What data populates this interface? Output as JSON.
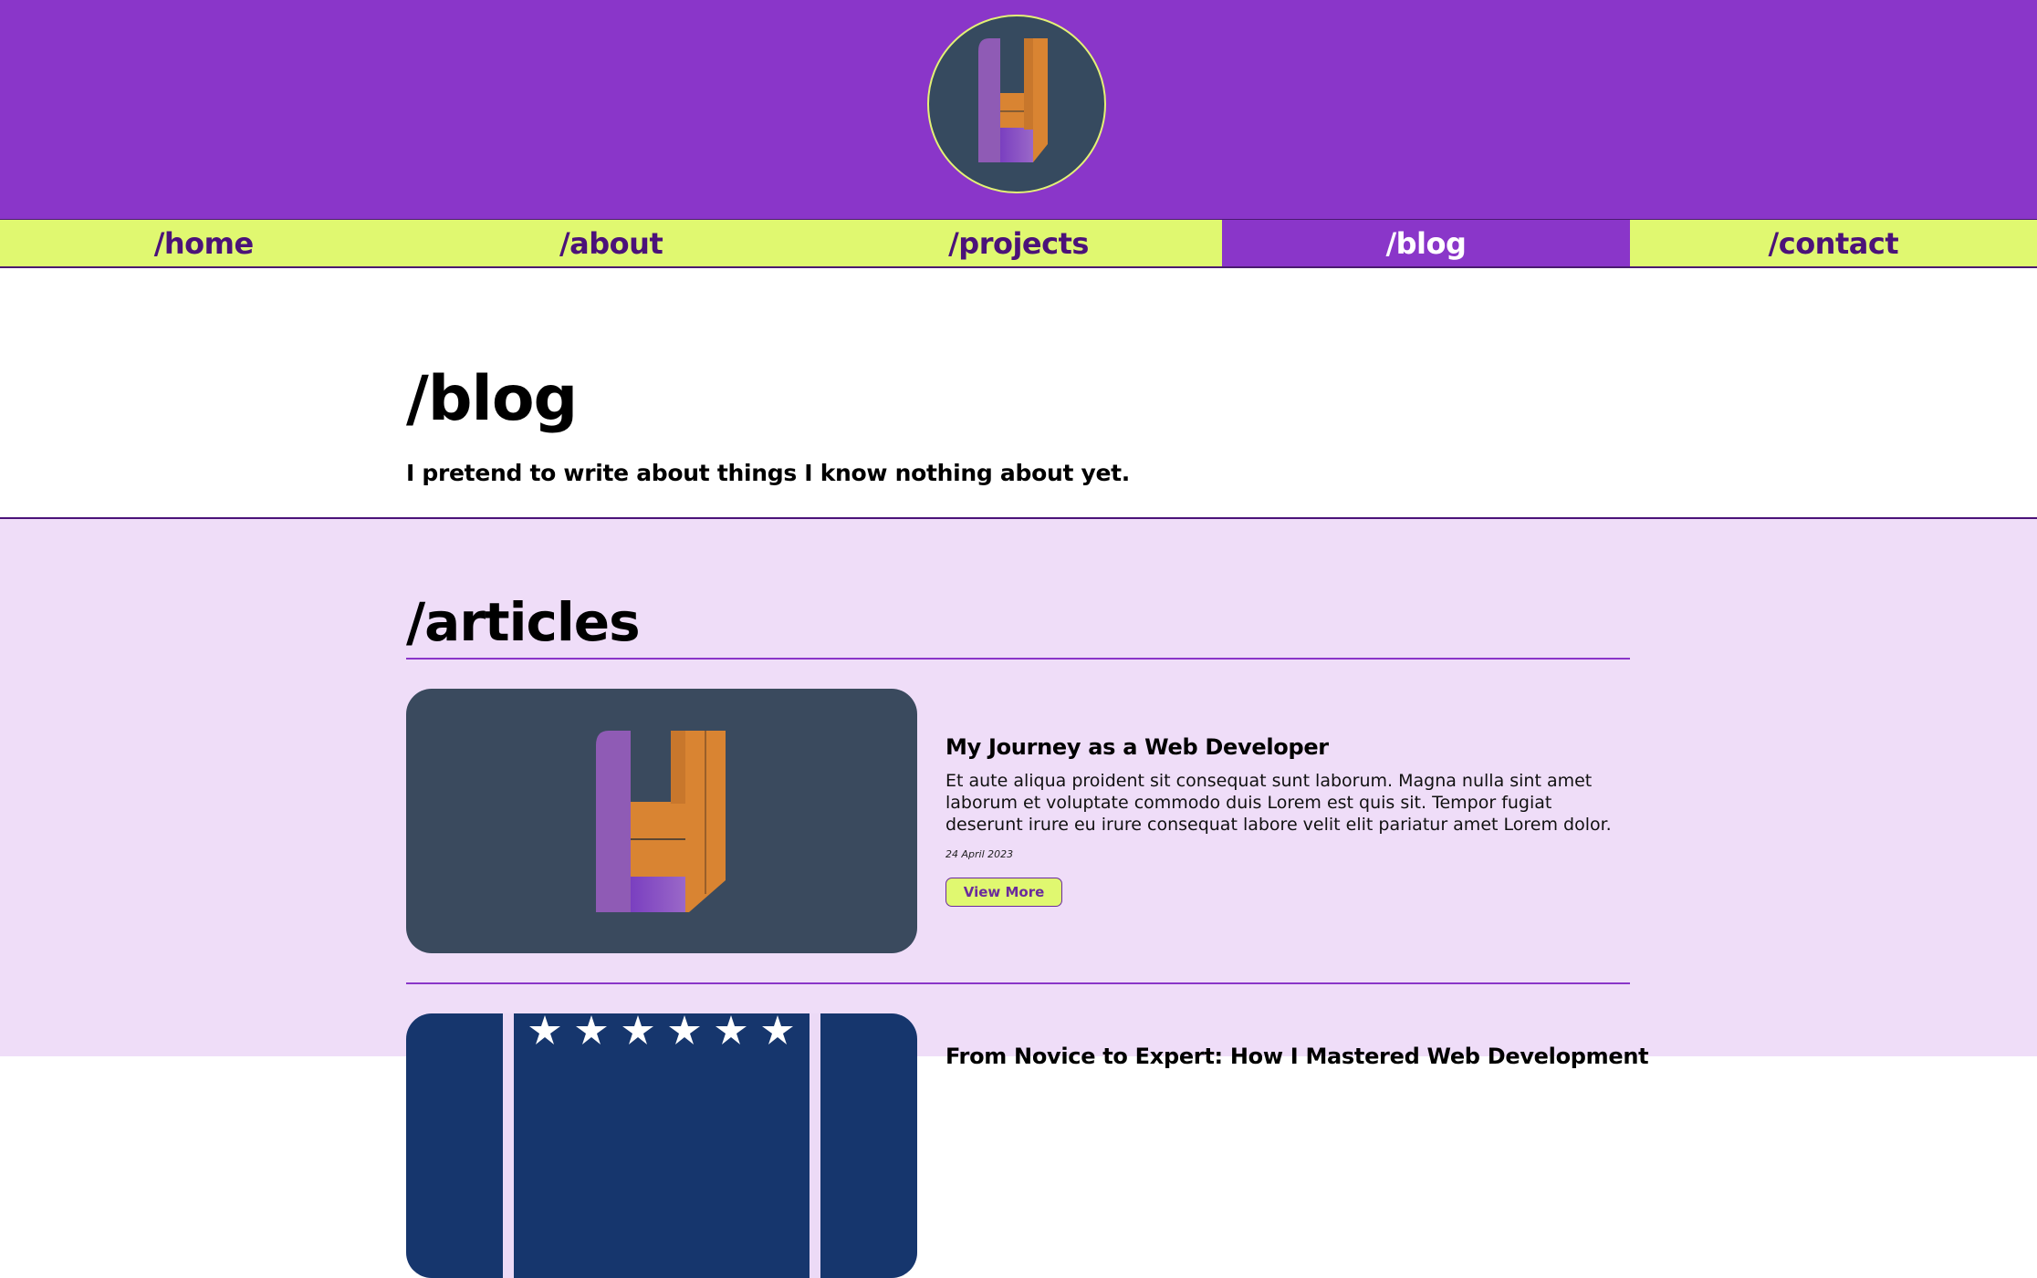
{
  "nav": {
    "items": [
      {
        "label": "/home"
      },
      {
        "label": "/about"
      },
      {
        "label": "/projects"
      },
      {
        "label": "/blog"
      },
      {
        "label": "/contact"
      }
    ],
    "active": "/blog"
  },
  "hero": {
    "title": "/blog",
    "subtitle": "I pretend to write about things I know nothing about yet."
  },
  "articles": {
    "title": "/articles",
    "items": [
      {
        "title": "My Journey as a Web Developer",
        "body": "Et aute aliqua proident sit consequat sunt laborum. Magna nulla sint amet laborum et voluptate commodo duis Lorem est quis sit. Tempor fugiat deserunt irure eu irure consequat labore velit elit pariatur amet Lorem dolor.",
        "date": "24 April 2023",
        "button": "View More"
      },
      {
        "title": "From Novice to Expert: How I Mastered Web Development"
      }
    ]
  },
  "colors": {
    "header_purple": "#8a36c9",
    "nav_lime": "#e0f870",
    "nav_text": "#4b1279",
    "articles_bg": "#efddf8",
    "logo_bg": "#364a5f",
    "logo_orange": "#d98432",
    "logo_purple": "#8f5bb5"
  }
}
